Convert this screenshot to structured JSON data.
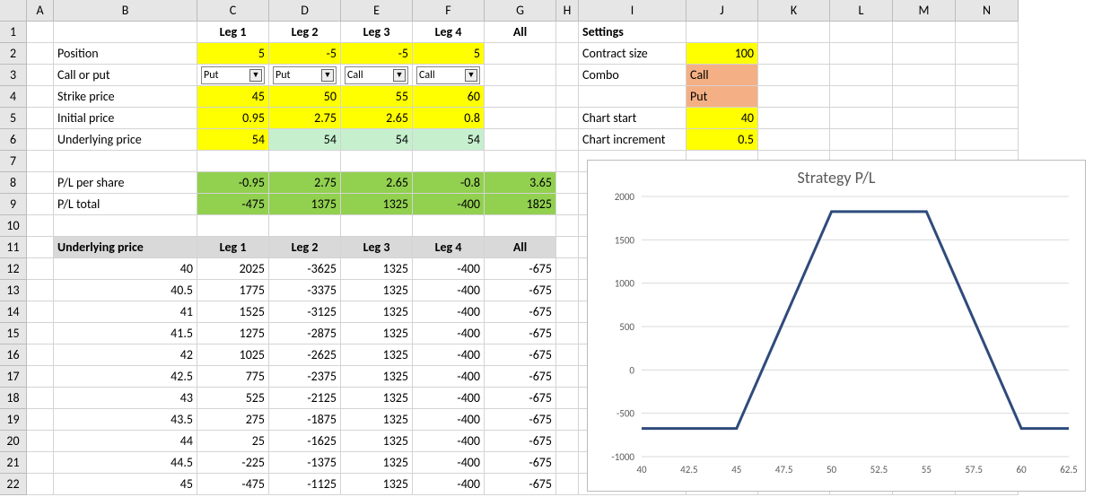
{
  "columns": [
    "A",
    "B",
    "C",
    "D",
    "E",
    "F",
    "G",
    "H",
    "I",
    "J",
    "K",
    "L",
    "M",
    "N"
  ],
  "rowCount": 22,
  "headers": {
    "leg1": "Leg 1",
    "leg2": "Leg 2",
    "leg3": "Leg 3",
    "leg4": "Leg 4",
    "all": "All",
    "settings": "Settings"
  },
  "labels": {
    "position": "Position",
    "callput": "Call or put",
    "strike": "Strike price",
    "initprice": "Initial price",
    "under": "Underlying price",
    "plshare": "P/L per share",
    "pltotal": "P/L total",
    "contractsize": "Contract size",
    "combo": "Combo",
    "chartstart": "Chart start",
    "chartinc": "Chart increment"
  },
  "inputs": {
    "position": {
      "c": "5",
      "d": "-5",
      "e": "-5",
      "f": "5"
    },
    "callput": {
      "c": "Put",
      "d": "Put",
      "e": "Call",
      "f": "Call"
    },
    "strike": {
      "c": "45",
      "d": "50",
      "e": "55",
      "f": "60"
    },
    "initprice": {
      "c": "0.95",
      "d": "2.75",
      "e": "2.65",
      "f": "0.8"
    },
    "under": {
      "c": "54",
      "d": "54",
      "e": "54",
      "f": "54"
    }
  },
  "settings": {
    "contractsize": "100",
    "combo1": "Call",
    "combo2": "Put",
    "chartstart": "40",
    "chartinc": "0.5"
  },
  "pl": {
    "share": {
      "c": "-0.95",
      "d": "2.75",
      "e": "2.65",
      "f": "-0.8",
      "g": "3.65"
    },
    "total": {
      "c": "-475",
      "d": "1375",
      "e": "1325",
      "f": "-400",
      "g": "1825"
    }
  },
  "tableHeader": {
    "b": "Underlying price",
    "c": "Leg 1",
    "d": "Leg 2",
    "e": "Leg 3",
    "f": "Leg 4",
    "g": "All"
  },
  "table": [
    {
      "u": "40",
      "c": "2025",
      "d": "-3625",
      "e": "1325",
      "f": "-400",
      "g": "-675"
    },
    {
      "u": "40.5",
      "c": "1775",
      "d": "-3375",
      "e": "1325",
      "f": "-400",
      "g": "-675"
    },
    {
      "u": "41",
      "c": "1525",
      "d": "-3125",
      "e": "1325",
      "f": "-400",
      "g": "-675"
    },
    {
      "u": "41.5",
      "c": "1275",
      "d": "-2875",
      "e": "1325",
      "f": "-400",
      "g": "-675"
    },
    {
      "u": "42",
      "c": "1025",
      "d": "-2625",
      "e": "1325",
      "f": "-400",
      "g": "-675"
    },
    {
      "u": "42.5",
      "c": "775",
      "d": "-2375",
      "e": "1325",
      "f": "-400",
      "g": "-675"
    },
    {
      "u": "43",
      "c": "525",
      "d": "-2125",
      "e": "1325",
      "f": "-400",
      "g": "-675"
    },
    {
      "u": "43.5",
      "c": "275",
      "d": "-1875",
      "e": "1325",
      "f": "-400",
      "g": "-675"
    },
    {
      "u": "44",
      "c": "25",
      "d": "-1625",
      "e": "1325",
      "f": "-400",
      "g": "-675"
    },
    {
      "u": "44.5",
      "c": "-225",
      "d": "-1375",
      "e": "1325",
      "f": "-400",
      "g": "-675"
    },
    {
      "u": "45",
      "c": "-475",
      "d": "-1125",
      "e": "1325",
      "f": "-400",
      "g": "-675"
    }
  ],
  "chart_data": {
    "type": "line",
    "title": "Strategy P/L",
    "xlabel": "",
    "ylabel": "",
    "x": [
      40,
      42.5,
      45,
      47.5,
      50,
      52.5,
      55,
      57.5,
      60,
      62.5
    ],
    "y": [
      -675,
      -675,
      -675,
      575,
      1825,
      1825,
      1825,
      575,
      -675,
      -675
    ],
    "ylim": [
      -1000,
      2000
    ],
    "yticks": [
      -1000,
      -500,
      0,
      500,
      1000,
      1500,
      2000
    ],
    "xticks": [
      40,
      42.5,
      45,
      47.5,
      50,
      52.5,
      55,
      57.5,
      60,
      62.5
    ]
  }
}
